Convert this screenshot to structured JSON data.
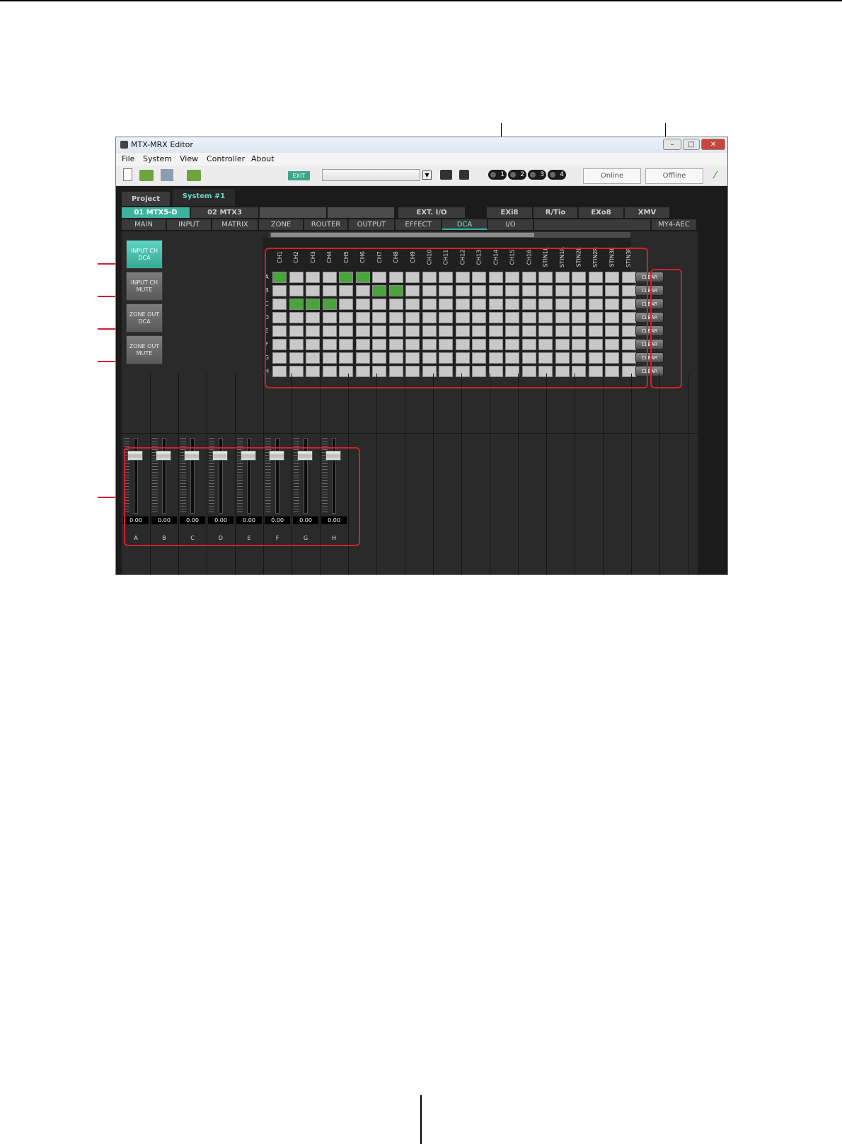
{
  "window": {
    "title": "MTX-MRX Editor",
    "controls": [
      "–",
      "□",
      "✕"
    ]
  },
  "menu": [
    "File",
    "System",
    "View",
    "Controller",
    "About"
  ],
  "toolbar": {
    "ext_label": "EXIT",
    "presets": [
      "1",
      "2",
      "3",
      "4"
    ],
    "online": "Online",
    "offline": "Offline"
  },
  "project_tabs": [
    "Project",
    "System #1"
  ],
  "device_tabs": [
    "01 MTX5-D",
    "02 MTX3",
    "",
    "",
    "EXT. I/O",
    "EXi8",
    "R/Tio",
    "EXo8",
    "XMV"
  ],
  "func_tabs": [
    "MAIN",
    "INPUT",
    "MATRIX",
    "ZONE",
    "ROUTER",
    "OUTPUT",
    "EFFECT",
    "DCA",
    "I/O",
    "MY4-AEC"
  ],
  "active_func_tab": "DCA",
  "side_buttons": [
    {
      "line1": "INPUT CH",
      "line2": "DCA",
      "active": true
    },
    {
      "line1": "INPUT CH",
      "line2": "MUTE",
      "active": false
    },
    {
      "line1": "ZONE OUT",
      "line2": "DCA",
      "active": false
    },
    {
      "line1": "ZONE OUT",
      "line2": "MUTE",
      "active": false
    }
  ],
  "scroll_label": "III",
  "matrix": {
    "columns": [
      "CH1",
      "CH2",
      "CH3",
      "CH4",
      "CH5",
      "CH6",
      "CH7",
      "CH8",
      "CH9",
      "CH10",
      "CH11",
      "CH12",
      "CH13",
      "CH14",
      "CH15",
      "CH16",
      "STIN1L",
      "STIN1R",
      "STIN2L",
      "STIN2R",
      "STIN3L",
      "STIN3R"
    ],
    "rows": [
      "A",
      "B",
      "C",
      "D",
      "E",
      "F",
      "G",
      "H"
    ],
    "assigned": {
      "A": [
        0,
        4,
        5
      ],
      "B": [
        6,
        7
      ],
      "C": [
        1,
        2,
        3
      ]
    }
  },
  "clear_label": "CLEAR",
  "faders": [
    {
      "label": "A",
      "value": "0.00"
    },
    {
      "label": "B",
      "value": "0.00"
    },
    {
      "label": "C",
      "value": "0.00"
    },
    {
      "label": "D",
      "value": "0.00"
    },
    {
      "label": "E",
      "value": "0.00"
    },
    {
      "label": "F",
      "value": "0.00"
    },
    {
      "label": "G",
      "value": "0.00"
    },
    {
      "label": "H",
      "value": "0.00"
    }
  ]
}
